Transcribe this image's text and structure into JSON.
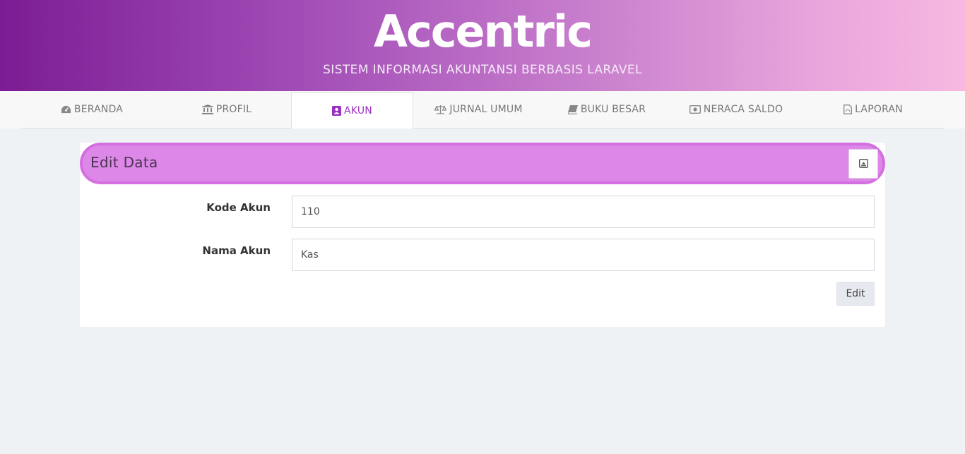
{
  "header": {
    "title": "Accentric",
    "subtitle": "SISTEM INFORMASI AKUNTANSI BERBASIS LARAVEL"
  },
  "nav": {
    "items": [
      {
        "label": "BERANDA",
        "icon": "dashboard-icon"
      },
      {
        "label": "PROFIL",
        "icon": "institution-icon"
      },
      {
        "label": "AKUN",
        "icon": "address-book-icon",
        "active": true
      },
      {
        "label": "JURNAL UMUM",
        "icon": "balance-scale-icon"
      },
      {
        "label": "BUKU BESAR",
        "icon": "book-icon"
      },
      {
        "label": "NERACA SALDO",
        "icon": "money-icon"
      },
      {
        "label": "LAPORAN",
        "icon": "file-pdf-icon"
      }
    ]
  },
  "card": {
    "title": "Edit Data",
    "tool_icon": "minimize-window-icon",
    "fields": [
      {
        "label": "Kode Akun",
        "value": "110"
      },
      {
        "label": "Nama Akun",
        "value": "Kas"
      }
    ],
    "submit_label": "Edit"
  },
  "colors": {
    "accent": "#9b30c4",
    "header_bg": "#dd88e8",
    "page_bg": "#eef2f5"
  }
}
